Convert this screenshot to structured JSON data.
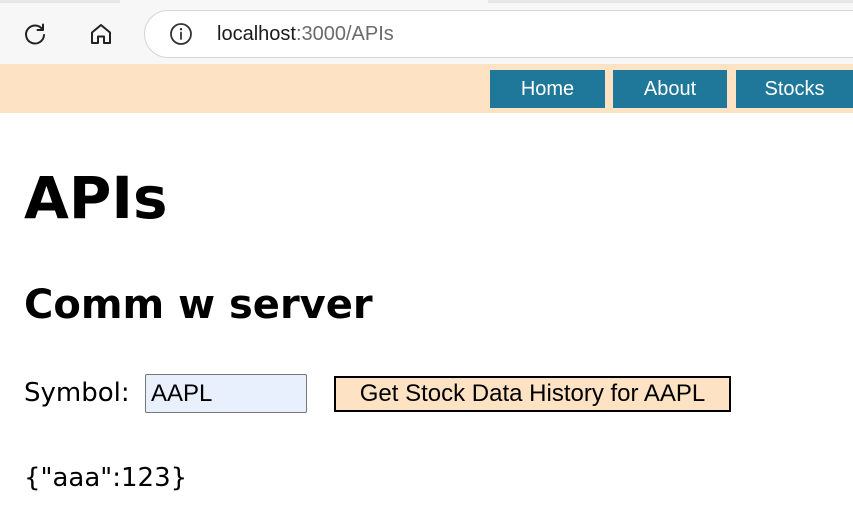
{
  "browser": {
    "url_host": "localhost",
    "url_path": ":3000/APIs",
    "icons": [
      "refresh-icon",
      "home-icon",
      "info-icon"
    ]
  },
  "site_nav": {
    "background": "#fde2c3",
    "link_color": "#1f7799",
    "links": [
      {
        "label": "Home"
      },
      {
        "label": "About"
      },
      {
        "label": "Stocks"
      }
    ]
  },
  "main": {
    "title": "APIs",
    "section_title": "Comm w server",
    "symbol_label": "Symbol:",
    "symbol_value": "AAPL",
    "fetch_button_label": "Get Stock Data History for AAPL",
    "result": "{\"aaa\":123}"
  }
}
